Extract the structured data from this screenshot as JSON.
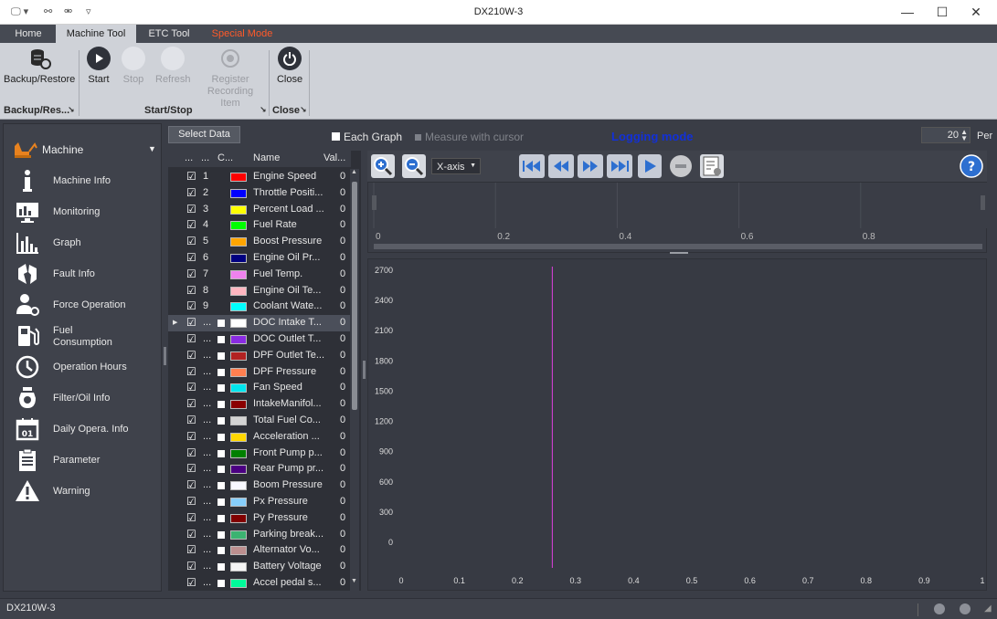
{
  "window": {
    "title": "DX210W-3"
  },
  "tabs": [
    {
      "label": "Home"
    },
    {
      "label": "Machine Tool"
    },
    {
      "label": "ETC Tool"
    },
    {
      "label": "Special Mode"
    }
  ],
  "ribbon": {
    "backup": {
      "label": "Backup/Restore"
    },
    "start": {
      "label": "Start"
    },
    "stop": {
      "label": "Stop"
    },
    "refresh": {
      "label": "Refresh"
    },
    "register": {
      "label1": "Register",
      "label2": "Recording Item"
    },
    "close": {
      "label": "Close"
    },
    "groups": {
      "backup": "Backup/Res...",
      "startstop": "Start/Stop",
      "close": "Close"
    }
  },
  "nav": {
    "header": "Machine",
    "items": [
      {
        "label": "Machine Info"
      },
      {
        "label": "Monitoring"
      },
      {
        "label": "Graph"
      },
      {
        "label": "Fault Info"
      },
      {
        "label": "Force Operation"
      },
      {
        "label": "Fuel",
        "label2": "Consumption"
      },
      {
        "label": "Operation Hours"
      },
      {
        "label": "Filter/Oil Info"
      },
      {
        "label": "Daily Opera. Info"
      },
      {
        "label": "Parameter"
      },
      {
        "label": "Warning"
      }
    ]
  },
  "graph": {
    "select_data": "Select Data",
    "each_graph": "Each Graph",
    "measure_cursor": "Measure with cursor",
    "logging_mode": "Logging mode",
    "period_value": "20",
    "period_label": "Per",
    "xaxis_select": "X-axis",
    "help": "?"
  },
  "list": {
    "headers": {
      "c1": "...",
      "c2": "...",
      "c3": "C...",
      "name": "Name",
      "value": "Val..."
    },
    "rows": [
      {
        "num": "1",
        "name": "Engine Speed",
        "val": "0",
        "color": "#ff0000"
      },
      {
        "num": "2",
        "name": "Throttle Positi...",
        "val": "0",
        "color": "#0000ff"
      },
      {
        "num": "3",
        "name": "Percent Load ...",
        "val": "0",
        "color": "#ffff00"
      },
      {
        "num": "4",
        "name": "Fuel Rate",
        "val": "0",
        "color": "#00ff00"
      },
      {
        "num": "5",
        "name": "Boost Pressure",
        "val": "0",
        "color": "#ffa500"
      },
      {
        "num": "6",
        "name": "Engine Oil Pr...",
        "val": "0",
        "color": "#000080"
      },
      {
        "num": "7",
        "name": "Fuel Temp.",
        "val": "0",
        "color": "#ee82ee"
      },
      {
        "num": "8",
        "name": "Engine Oil Te...",
        "val": "0",
        "color": "#ffb6c1"
      },
      {
        "num": "9",
        "name": "Coolant Wate...",
        "val": "0",
        "color": "#00ffff"
      },
      {
        "num": "...",
        "name": "DOC Intake T...",
        "val": "0",
        "color": "#ffffff"
      },
      {
        "num": "...",
        "name": "DOC Outlet T...",
        "val": "0",
        "color": "#8a2be2"
      },
      {
        "num": "...",
        "name": "DPF Outlet Te...",
        "val": "0",
        "color": "#b22222"
      },
      {
        "num": "...",
        "name": "DPF Pressure",
        "val": "0",
        "color": "#ff7f50"
      },
      {
        "num": "...",
        "name": "Fan Speed",
        "val": "0",
        "color": "#00e5ee"
      },
      {
        "num": "...",
        "name": "IntakeManifol...",
        "val": "0",
        "color": "#8b0000"
      },
      {
        "num": "...",
        "name": "Total Fuel Co...",
        "val": "0",
        "color": "#d3d3d3"
      },
      {
        "num": "...",
        "name": "Acceleration ...",
        "val": "0",
        "color": "#ffd700"
      },
      {
        "num": "...",
        "name": "Front Pump p...",
        "val": "0",
        "color": "#008000"
      },
      {
        "num": "...",
        "name": "Rear Pump pr...",
        "val": "0",
        "color": "#4b0082"
      },
      {
        "num": "...",
        "name": "Boom Pressure",
        "val": "0",
        "color": "#f8f8ff"
      },
      {
        "num": "...",
        "name": "Px Pressure",
        "val": "0",
        "color": "#87cefa"
      },
      {
        "num": "...",
        "name": "Py Pressure",
        "val": "0",
        "color": "#800000"
      },
      {
        "num": "...",
        "name": "Parking break...",
        "val": "0",
        "color": "#3cb371"
      },
      {
        "num": "...",
        "name": "Alternator Vo...",
        "val": "0",
        "color": "#bc8f8f"
      },
      {
        "num": "...",
        "name": "Battery Voltage",
        "val": "0",
        "color": "#f5f5f5"
      },
      {
        "num": "...",
        "name": "Accel pedal s...",
        "val": "0",
        "color": "#00fa9a"
      }
    ]
  },
  "chart_data": {
    "type": "line",
    "x_ticks": [
      "0",
      "0.1",
      "0.2",
      "0.3",
      "0.4",
      "0.5",
      "0.6",
      "0.7",
      "0.8",
      "0.9",
      "1"
    ],
    "y_ticks": [
      "2700",
      "2400",
      "2100",
      "1800",
      "1500",
      "1200",
      "900",
      "600",
      "300",
      "0"
    ],
    "xlim": [
      0,
      1
    ],
    "ylim": [
      0,
      2700
    ],
    "cursor_x": 0.26,
    "cursor_color": "#e040e0",
    "overview_ticks": [
      "0",
      "0.2",
      "0.4",
      "0.6",
      "0.8"
    ],
    "grid": false
  },
  "status": {
    "label": "DX210W-3"
  }
}
